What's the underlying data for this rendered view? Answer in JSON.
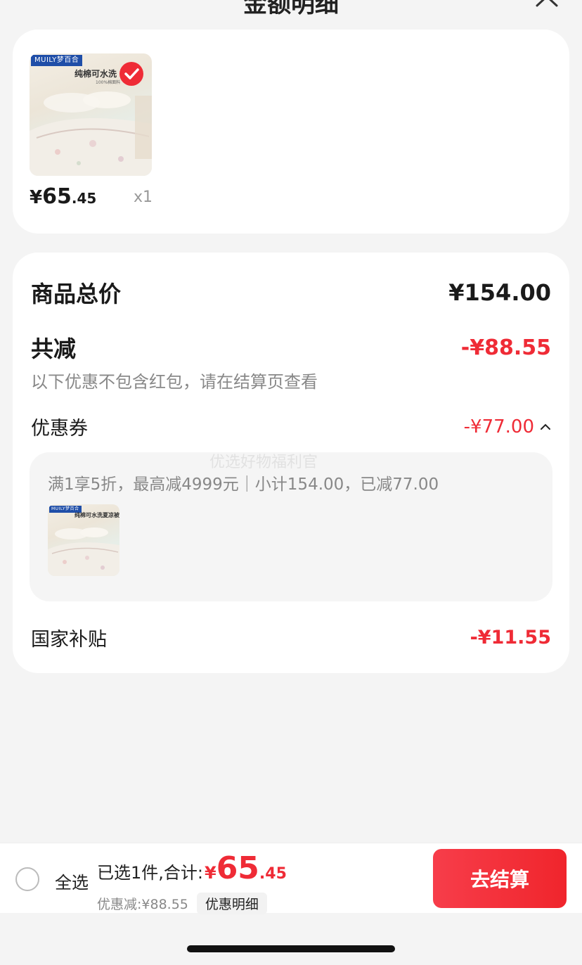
{
  "header": {
    "title": "金额明细"
  },
  "product": {
    "brand": "MUILY梦百合",
    "image_title": "纯棉可水洗",
    "image_sub": "100%棉面料",
    "price_yen": "¥",
    "price_int": "65",
    "price_dec": ".45",
    "qty": "x1"
  },
  "summary": {
    "total_label": "商品总价",
    "total_value": "¥154.00",
    "reduce_label": "共减",
    "reduce_value": "-¥88.55",
    "note": "以下优惠不包含红包，请在结算页查看",
    "coupon_label": "优惠券",
    "coupon_value": "-¥77.00",
    "coupon_rule": "满1享5折，最高减4999元｜小计154.00，已减77.00",
    "coupon_item_title": "纯棉可水洗夏凉被",
    "watermark": "优选好物福利官",
    "subsidy_label": "国家补贴",
    "subsidy_value": "-¥11.55"
  },
  "bottom": {
    "select_all": "全选",
    "selected_text": "已选1件,合计:",
    "total_yen": "¥",
    "total_int": "65",
    "total_dec": ".45",
    "discount_text": "优惠减:¥88.55",
    "detail_chip": "优惠明细",
    "checkout": "去结算"
  },
  "colors": {
    "accent": "#ef2b36",
    "bg": "#f4f4f4"
  }
}
